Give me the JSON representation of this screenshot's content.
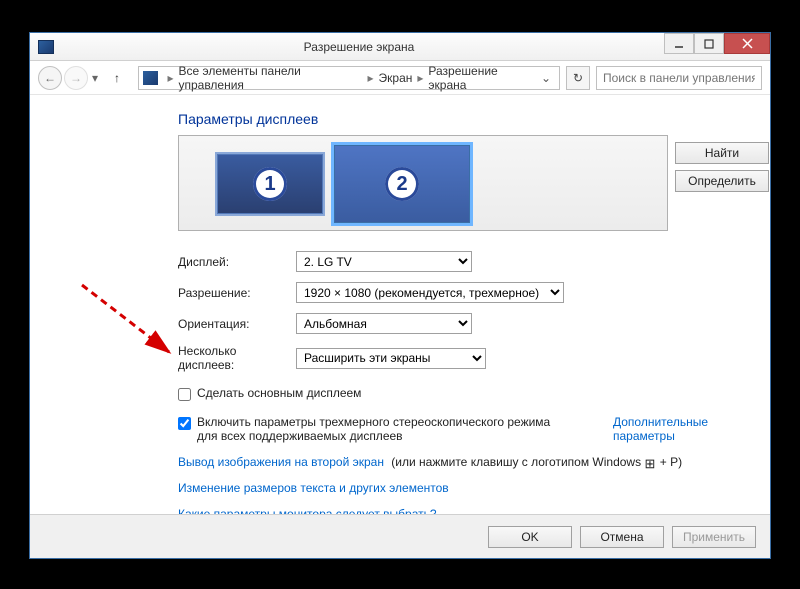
{
  "window": {
    "title": "Разрешение экрана"
  },
  "nav": {
    "crumb1": "Все элементы панели управления",
    "crumb2": "Экран",
    "crumb3": "Разрешение экрана",
    "search_placeholder": "Поиск в панели управления"
  },
  "page": {
    "heading": "Параметры дисплеев",
    "monitor1_num": "1",
    "monitor2_num": "2",
    "find_btn": "Найти",
    "identify_btn": "Определить",
    "display_label": "Дисплей:",
    "display_value": "2. LG TV",
    "resolution_label": "Разрешение:",
    "resolution_value": "1920 × 1080 (рекомендуется, трехмерное)",
    "orientation_label": "Ориентация:",
    "orientation_value": "Альбомная",
    "multi_label": "Несколько дисплеев:",
    "multi_value": "Расширить эти экраны",
    "make_primary": "Сделать основным дисплеем",
    "enable_3d": "Включить параметры трехмерного стереоскопического режима для всех поддерживаемых дисплеев",
    "advanced_link": "Дополнительные параметры",
    "project_link": "Вывод изображения на второй экран",
    "project_hint": " (или нажмите клавишу с логотипом Windows ",
    "project_hint2": " + P)",
    "text_size_link": "Изменение размеров текста и других элементов",
    "which_link": "Какие параметры монитора следует выбрать?",
    "ok": "OK",
    "cancel": "Отмена",
    "apply": "Применить"
  }
}
